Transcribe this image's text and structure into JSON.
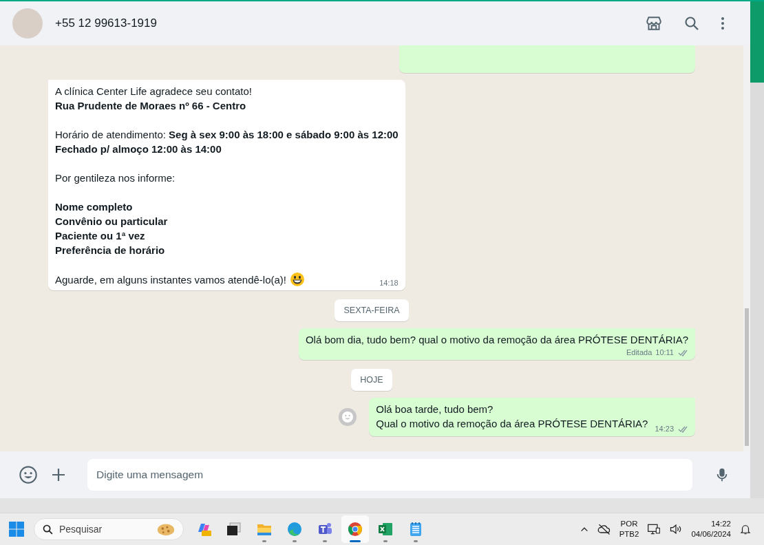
{
  "header": {
    "contact": "+55 12 99613-1919"
  },
  "messages": [
    {
      "kind": "cut"
    },
    {
      "kind": "incoming",
      "time": "14:18",
      "paragraphs": [
        [
          {
            "text": "A clínica Center Life agradece seu contato!",
            "bold": false
          },
          {
            "text": "Rua Prudente de Moraes nº 66 - Centro",
            "bold": true
          }
        ],
        [
          {
            "text": "Horário de atendimento: **Seg à sex 9:00 às 18:00 e sábado 9:00 às 12:00**",
            "bold": false
          },
          {
            "text": "Fechado p/ almoço 12:00 às 14:00",
            "bold": true
          }
        ],
        [
          {
            "text": "Por gentileza nos informe:",
            "bold": false
          }
        ],
        [
          {
            "text": "Nome completo",
            "bold": true
          },
          {
            "text": "Convênio ou particular",
            "bold": true
          },
          {
            "text": "Paciente ou 1ª vez",
            "bold": true
          },
          {
            "text": "Preferência de horário",
            "bold": true
          }
        ],
        [
          {
            "text": "Aguarde, em alguns instantes vamos atendê-lo(a)!",
            "bold": false,
            "emoji": true
          }
        ]
      ]
    },
    {
      "kind": "date",
      "label": "SEXTA-FEIRA"
    },
    {
      "kind": "outgoing",
      "edited": "Editada",
      "time": "10:11",
      "read": false,
      "reaction_button": false,
      "paragraphs": [
        [
          {
            "text": "Olá bom dia, tudo bem? qual o motivo da remoção da área PRÓTESE DENTÁRIA?",
            "bold": false
          }
        ]
      ]
    },
    {
      "kind": "date",
      "label": "HOJE"
    },
    {
      "kind": "outgoing",
      "time": "14:23",
      "read": false,
      "reaction_button": true,
      "paragraphs": [
        [
          {
            "text": "Olá boa tarde, tudo bem?",
            "bold": false
          },
          {
            "text": "Qual o motivo da remoção da área PRÓTESE DENTÁRIA?",
            "bold": false
          }
        ]
      ]
    }
  ],
  "composer": {
    "placeholder": "Digite uma mensagem"
  },
  "taskbar": {
    "search": {
      "placeholder": "Pesquisar"
    },
    "apps": [
      {
        "kind": "copilot",
        "running": false,
        "active": false
      },
      {
        "kind": "taskview",
        "running": false,
        "active": false
      },
      {
        "kind": "folder",
        "running": true,
        "active": false
      },
      {
        "kind": "edge",
        "running": true,
        "active": false
      },
      {
        "kind": "teams",
        "running": true,
        "active": false
      },
      {
        "kind": "chrome",
        "running": true,
        "active": true
      },
      {
        "kind": "excel",
        "running": true,
        "active": false
      },
      {
        "kind": "notepad",
        "running": true,
        "active": false
      }
    ],
    "language": [
      "POR",
      "PTB2"
    ],
    "time": "14:22",
    "date": "04/06/2024"
  }
}
